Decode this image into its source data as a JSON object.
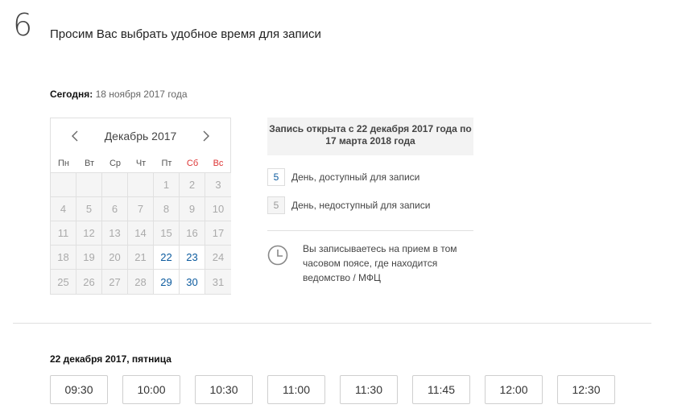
{
  "step": {
    "number": "6",
    "title": "Просим Вас выбрать удобное время для записи"
  },
  "today": {
    "label": "Сегодня:",
    "value": "18 ноября 2017 года"
  },
  "calendar": {
    "month_title": "Декабрь 2017",
    "weekdays": [
      "Пн",
      "Вт",
      "Ср",
      "Чт",
      "Пт",
      "Сб",
      "Вс"
    ],
    "weekend_indices": [
      5,
      6
    ],
    "days": [
      {
        "d": "",
        "s": "empty"
      },
      {
        "d": "",
        "s": "empty"
      },
      {
        "d": "",
        "s": "empty"
      },
      {
        "d": "",
        "s": "empty"
      },
      {
        "d": "1",
        "s": "unavailable"
      },
      {
        "d": "2",
        "s": "unavailable"
      },
      {
        "d": "3",
        "s": "unavailable"
      },
      {
        "d": "4",
        "s": "unavailable"
      },
      {
        "d": "5",
        "s": "unavailable"
      },
      {
        "d": "6",
        "s": "unavailable"
      },
      {
        "d": "7",
        "s": "unavailable"
      },
      {
        "d": "8",
        "s": "unavailable"
      },
      {
        "d": "9",
        "s": "unavailable"
      },
      {
        "d": "10",
        "s": "unavailable"
      },
      {
        "d": "11",
        "s": "unavailable"
      },
      {
        "d": "12",
        "s": "unavailable"
      },
      {
        "d": "13",
        "s": "unavailable"
      },
      {
        "d": "14",
        "s": "unavailable"
      },
      {
        "d": "15",
        "s": "unavailable"
      },
      {
        "d": "16",
        "s": "unavailable"
      },
      {
        "d": "17",
        "s": "unavailable"
      },
      {
        "d": "18",
        "s": "unavailable"
      },
      {
        "d": "19",
        "s": "unavailable"
      },
      {
        "d": "20",
        "s": "unavailable"
      },
      {
        "d": "21",
        "s": "unavailable"
      },
      {
        "d": "22",
        "s": "available"
      },
      {
        "d": "23",
        "s": "available"
      },
      {
        "d": "24",
        "s": "unavailable"
      },
      {
        "d": "25",
        "s": "unavailable"
      },
      {
        "d": "26",
        "s": "unavailable"
      },
      {
        "d": "27",
        "s": "unavailable"
      },
      {
        "d": "28",
        "s": "unavailable"
      },
      {
        "d": "29",
        "s": "available"
      },
      {
        "d": "30",
        "s": "available"
      },
      {
        "d": "31",
        "s": "unavailable"
      }
    ]
  },
  "info": {
    "text": "Запись открыта с 22 декабря 2017 года по 17 марта 2018 года"
  },
  "legend": {
    "available": {
      "sample": "5",
      "label": "День, доступный для записи"
    },
    "unavailable": {
      "sample": "5",
      "label": "День, недоступный для записи"
    }
  },
  "timezone_note": "Вы записываетесь на прием в том часовом поясе, где находится ведомство / МФЦ",
  "selected_date_heading": "22 декабря 2017, пятница",
  "time_slots": [
    "09:30",
    "10:00",
    "10:30",
    "11:00",
    "11:30",
    "11:45",
    "12:00",
    "12:30"
  ],
  "colors": {
    "available_day": "#0b5a9e",
    "weekend": "#d33333",
    "unavailable_bg": "#f5f5f5"
  },
  "icons": {
    "prev": "chevron-left-icon",
    "next": "chevron-right-icon",
    "timezone": "clock-icon"
  }
}
